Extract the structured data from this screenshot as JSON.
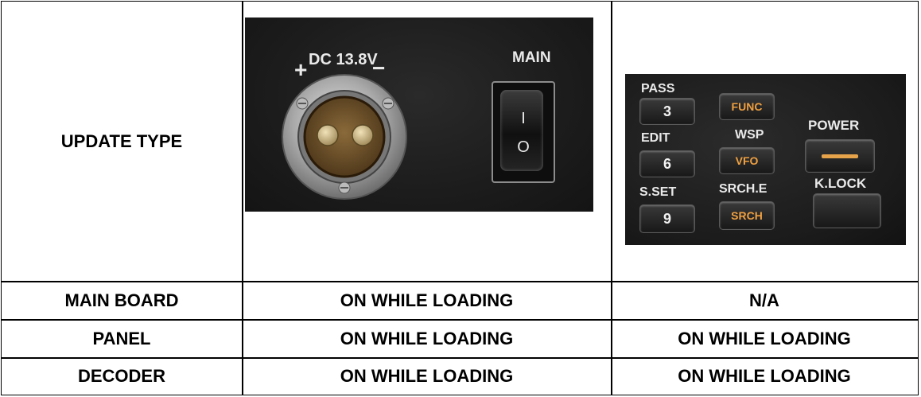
{
  "table": {
    "header": {
      "label": "UPDATE TYPE"
    },
    "rows": [
      {
        "type": "MAIN BOARD",
        "col1": "ON WHILE LOADING",
        "col2": "N/A"
      },
      {
        "type": "PANEL",
        "col1": "ON WHILE LOADING",
        "col2": "ON WHILE LOADING"
      },
      {
        "type": "DECODER",
        "col1": "ON WHILE LOADING",
        "col2": "ON WHILE LOADING"
      }
    ]
  },
  "photo_dc": {
    "dc_label": "DC 13.8V",
    "plus": "+",
    "minus": "−",
    "main_label": "MAIN",
    "switch_on": "I",
    "switch_off": "O"
  },
  "photo_panel": {
    "labels": {
      "pass": "PASS",
      "edit": "EDIT",
      "sset": "S.SET",
      "wsp": "WSP",
      "srche": "SRCH.E",
      "power": "POWER",
      "klock": "K.LOCK"
    },
    "keys": {
      "k3": "3",
      "k6": "6",
      "k9": "9",
      "func": "FUNC",
      "vfo": "VFO",
      "srch": "SRCH"
    }
  }
}
